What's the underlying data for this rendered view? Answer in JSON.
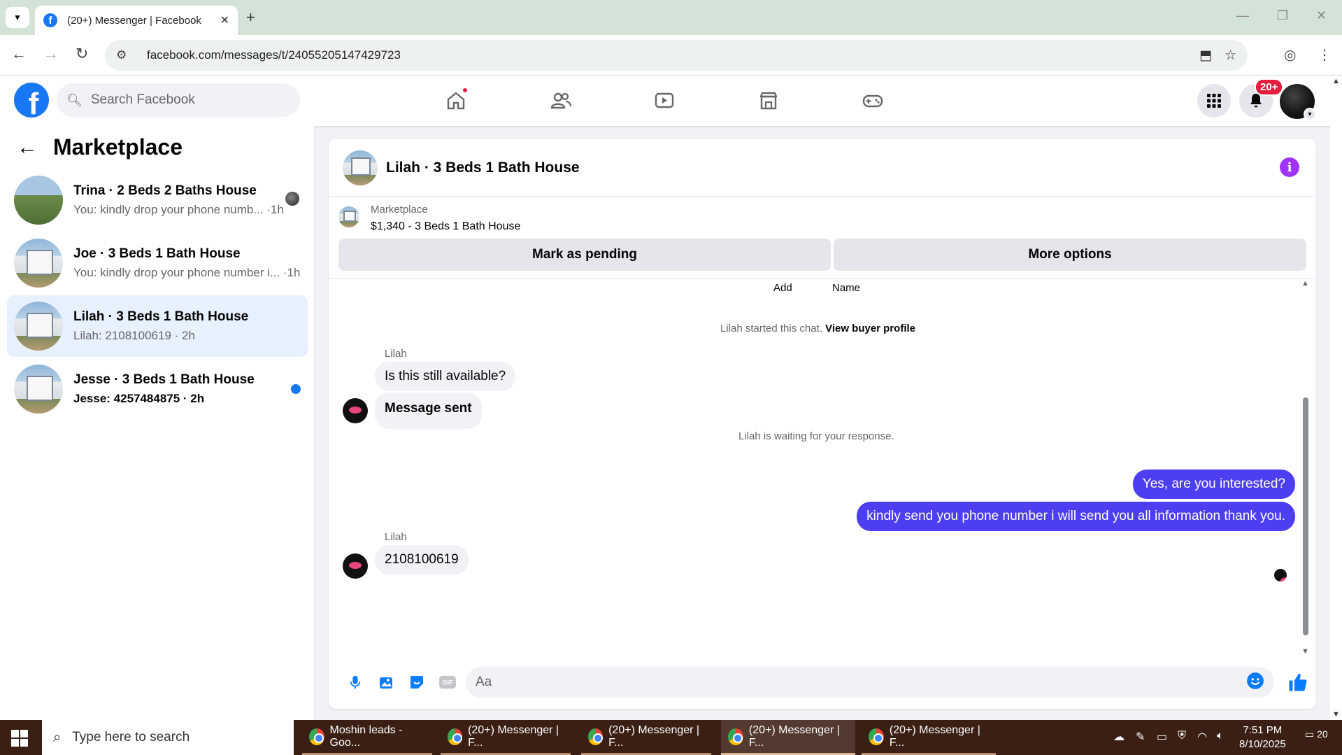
{
  "browser": {
    "tab_title": "(20+) Messenger | Facebook",
    "url": "facebook.com/messages/t/24055205147429723"
  },
  "header": {
    "search_placeholder": "Search Facebook",
    "notification_badge": "20+",
    "nav_icons": [
      "home-icon",
      "friends-icon",
      "watch-icon",
      "marketplace-icon",
      "gaming-icon"
    ]
  },
  "sidebar": {
    "title": "Marketplace",
    "conversations": [
      {
        "name": "Trina · 2 Beds 2 Baths House",
        "preview": "You: kindly drop your phone numb... ·1h"
      },
      {
        "name": "Joe · 3 Beds 1 Bath House",
        "preview": "You: kindly drop your phone number i... ·1h"
      },
      {
        "name": "Lilah · 3 Beds 1 Bath House",
        "preview": "Lilah: 2108100619 · 2h"
      },
      {
        "name": "Jesse · 3 Beds 1 Bath House",
        "preview": "Jesse: 4257484875 · 2h"
      }
    ]
  },
  "chat": {
    "title": "Lilah · 3 Beds 1 Bath House",
    "listing_source": "Marketplace",
    "listing_price": "$1,340 - 3 Beds 1 Bath House",
    "mark_pending_label": "Mark as pending",
    "more_options_label": "More options",
    "add_label": "Add",
    "name_label": "Name",
    "started_text": "Lilah started this chat.",
    "view_profile_link": "View buyer profile",
    "sender_name": "Lilah",
    "msg1": "Is this still available?",
    "msg2": "Message sent",
    "waiting_text": "Lilah is waiting for your response.",
    "out1": "Yes, are you interested?",
    "out2": "kindly send you phone number i will send you all information thank you.",
    "sender_name2": "Lilah",
    "msg3": "2108100619",
    "composer_placeholder": "Aa"
  },
  "taskbar": {
    "search_placeholder": "Type here to search",
    "items": [
      "Moshin leads - Goo...",
      "(20+) Messenger | F...",
      "(20+) Messenger | F...",
      "(20+) Messenger | F...",
      "(20+) Messenger | F..."
    ],
    "time": "7:51 PM",
    "date": "8/10/2025",
    "notification_count": "20"
  },
  "colors": {
    "brand": "#1877f2",
    "outgoing_bubble": "#4b3ff1",
    "active_conversation": "#e7f0fd"
  }
}
